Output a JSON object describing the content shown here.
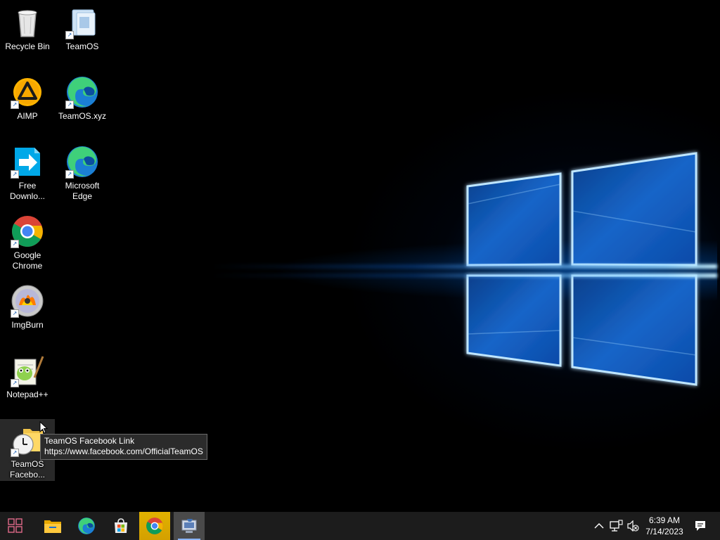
{
  "desktop": {
    "icons": [
      {
        "label": "Recycle Bin"
      },
      {
        "label": "TeamOS"
      },
      {
        "label": "AIMP"
      },
      {
        "label": "TeamOS.xyz"
      },
      {
        "label_line1": "Free",
        "label_line2": "Downlo..."
      },
      {
        "label_line1": "Microsoft",
        "label_line2": "Edge"
      },
      {
        "label_line1": "Google",
        "label_line2": "Chrome"
      },
      {
        "label": "ImgBurn"
      },
      {
        "label": "Notepad++"
      },
      {
        "label_line1": "TeamOS",
        "label_line2": "Facebo..."
      }
    ]
  },
  "tooltip": {
    "title": "TeamOS Facebook Link",
    "url": "https://www.facebook.com/OfficialTeamOS"
  },
  "taskbar": {
    "start_icon": "start-grid-icon",
    "pinned": [
      "file-explorer-icon",
      "edge-icon",
      "store-icon",
      "chrome-icon",
      "network-app-icon"
    ],
    "clock_time": "6:39 AM",
    "clock_date": "7/14/2023",
    "colors": {
      "taskbar_bg": "#1c1c1c",
      "start_accent": "#e06a8a",
      "active_chrome_bg": "#d4a000"
    }
  }
}
